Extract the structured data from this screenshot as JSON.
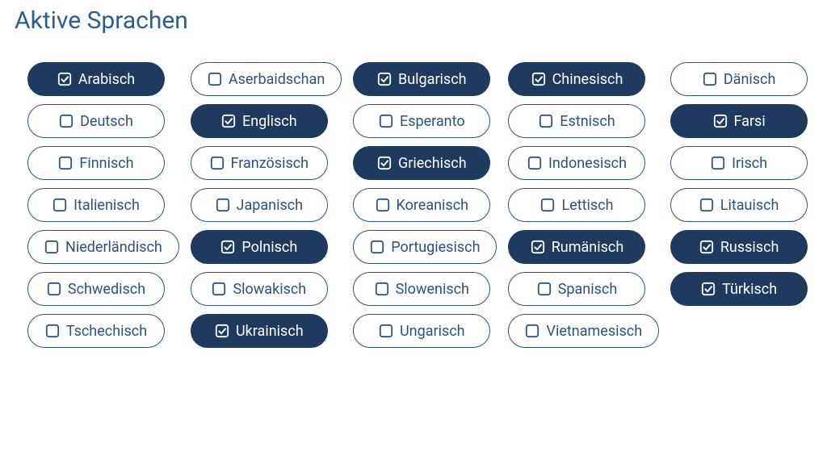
{
  "title": "Aktive Sprachen",
  "languages": [
    [
      {
        "label": "Arabisch",
        "selected": true,
        "slug": "arabisch"
      },
      {
        "label": "Aserbaidschan",
        "selected": false,
        "slug": "aserbaidschan"
      },
      {
        "label": "Bulgarisch",
        "selected": true,
        "slug": "bulgarisch"
      },
      {
        "label": "Chinesisch",
        "selected": true,
        "slug": "chinesisch"
      },
      {
        "label": "Dänisch",
        "selected": false,
        "slug": "daenisch"
      }
    ],
    [
      {
        "label": "Deutsch",
        "selected": false,
        "slug": "deutsch"
      },
      {
        "label": "Englisch",
        "selected": true,
        "slug": "englisch"
      },
      {
        "label": "Esperanto",
        "selected": false,
        "slug": "esperanto"
      },
      {
        "label": "Estnisch",
        "selected": false,
        "slug": "estnisch"
      },
      {
        "label": "Farsi",
        "selected": true,
        "slug": "farsi"
      }
    ],
    [
      {
        "label": "Finnisch",
        "selected": false,
        "slug": "finnisch"
      },
      {
        "label": "Französisch",
        "selected": false,
        "slug": "franzoesisch"
      },
      {
        "label": "Griechisch",
        "selected": true,
        "slug": "griechisch"
      },
      {
        "label": "Indonesisch",
        "selected": false,
        "slug": "indonesisch"
      },
      {
        "label": "Irisch",
        "selected": false,
        "slug": "irisch"
      }
    ],
    [
      {
        "label": "Italienisch",
        "selected": false,
        "slug": "italienisch"
      },
      {
        "label": "Japanisch",
        "selected": false,
        "slug": "japanisch"
      },
      {
        "label": "Koreanisch",
        "selected": false,
        "slug": "koreanisch"
      },
      {
        "label": "Lettisch",
        "selected": false,
        "slug": "lettisch"
      },
      {
        "label": "Litauisch",
        "selected": false,
        "slug": "litauisch"
      }
    ],
    [
      {
        "label": "Niederländisch",
        "selected": false,
        "slug": "niederlaendisch"
      },
      {
        "label": "Polnisch",
        "selected": true,
        "slug": "polnisch"
      },
      {
        "label": "Portugiesisch",
        "selected": false,
        "slug": "portugiesisch"
      },
      {
        "label": "Rumänisch",
        "selected": true,
        "slug": "rumaenisch"
      },
      {
        "label": "Russisch",
        "selected": true,
        "slug": "russisch"
      }
    ],
    [
      {
        "label": "Schwedisch",
        "selected": false,
        "slug": "schwedisch"
      },
      {
        "label": "Slowakisch",
        "selected": false,
        "slug": "slowakisch"
      },
      {
        "label": "Slowenisch",
        "selected": false,
        "slug": "slowenisch"
      },
      {
        "label": "Spanisch",
        "selected": false,
        "slug": "spanisch"
      },
      {
        "label": "Türkisch",
        "selected": true,
        "slug": "tuerkisch"
      }
    ],
    [
      {
        "label": "Tschechisch",
        "selected": false,
        "slug": "tschechisch"
      },
      {
        "label": "Ukrainisch",
        "selected": true,
        "slug": "ukrainisch"
      },
      {
        "label": "Ungarisch",
        "selected": false,
        "slug": "ungarisch"
      },
      {
        "label": "Vietnamesisch",
        "selected": false,
        "slug": "vietnamesisch"
      }
    ]
  ]
}
